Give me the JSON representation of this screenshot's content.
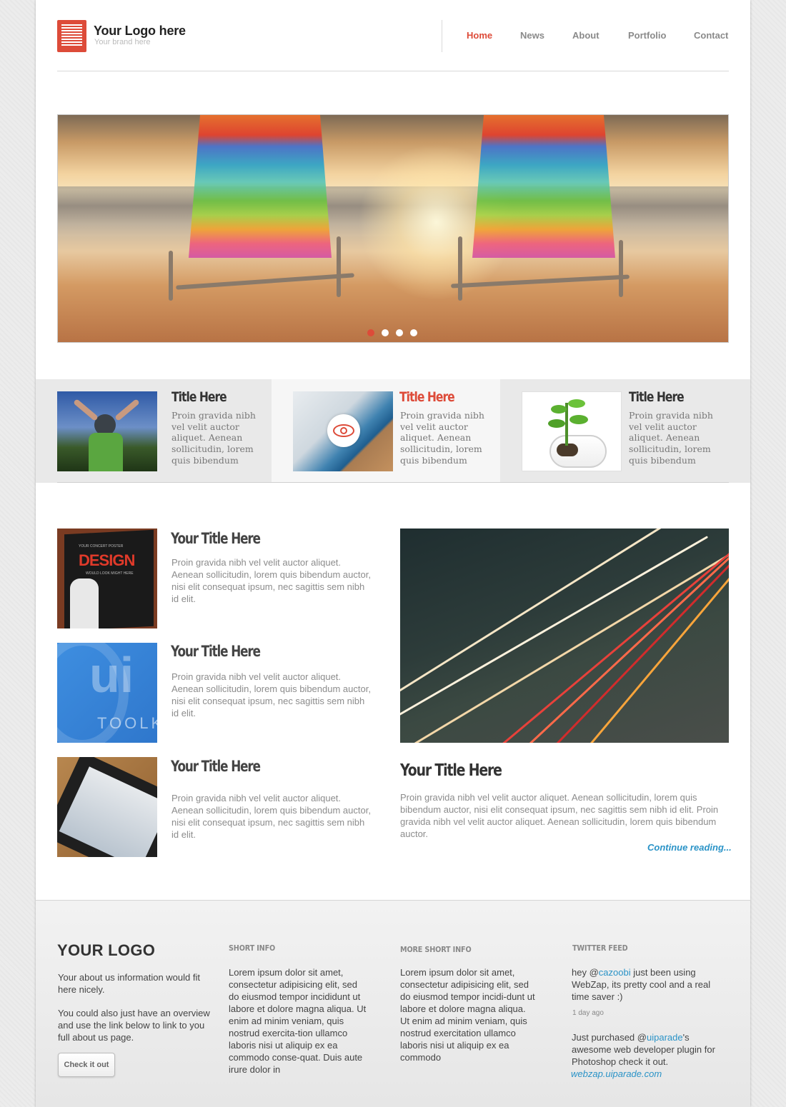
{
  "header": {
    "logo_title": "Your Logo here",
    "logo_subtitle": "Your brand here",
    "nav": [
      "Home",
      "News",
      "About",
      "Portfolio",
      "Contact"
    ],
    "active_nav": "Home",
    "accent_color": "#dd4b39"
  },
  "slider": {
    "dots_count": 4,
    "active_dot": 1
  },
  "features": [
    {
      "title": "Title Here",
      "body": "Proin gravida nibh vel velit auctor aliquet. Aenean sollicitudin, lorem quis bibendum"
    },
    {
      "title": "Title Here",
      "body": "Proin gravida nibh vel velit auctor aliquet. Aenean sollicitudin, lorem quis bibendum"
    },
    {
      "title": "Title Here",
      "body": "Proin gravida nibh vel velit auctor aliquet. Aenean sollicitudin, lorem quis bibendum"
    }
  ],
  "articles": [
    {
      "title": "Your Title Here",
      "body": "Proin gravida nibh vel velit auctor aliquet. Aenean sollicitudin, lorem quis bibendum auctor, nisi elit consequat ipsum, nec sagittis sem nibh id elit.",
      "poster_line1": "YOUR CONCERT POSTER",
      "poster_big": "DESIGN",
      "poster_line2": "WOULD LOOK MIGHT HERE"
    },
    {
      "title": "Your Title Here",
      "body": "Proin gravida nibh vel velit auctor aliquet. Aenean sollicitudin, lorem quis bibendum auctor, nisi elit consequat ipsum, nec sagittis sem nibh id elit.",
      "thumb_big": "ui",
      "thumb_small": "TOOLK"
    },
    {
      "title": "Your Title Here",
      "body": "Proin gravida nibh vel velit auctor aliquet. Aenean sollicitudin, lorem quis bibendum auctor, nisi elit consequat ipsum, nec sagittis sem nibh id elit."
    }
  ],
  "featured": {
    "title": "Your Title Here",
    "body": "Proin gravida nibh vel velit auctor aliquet. Aenean sollicitudin, lorem quis bibendum auctor, nisi elit consequat ipsum, nec sagittis sem nibh id elit. Proin gravida nibh vel velit auctor aliquet. Aenean sollicitudin, lorem quis bibendum auctor.",
    "link": "Continue reading..."
  },
  "footer": {
    "logo": "YOUR LOGO",
    "about1": "Your about us information would fit here nicely.",
    "about2": "You could also just have an overview and use the link below to link to you full about us page.",
    "button": "Check it out",
    "short_info_heading": "SHORT INFO",
    "short_info": "Lorem ipsum dolor sit amet, consectetur adipisicing elit, sed do eiusmod tempor incididunt ut labore et dolore magna aliqua. Ut enim ad minim veniam, quis nostrud exercita-tion ullamco laboris nisi ut aliquip ex ea commodo conse-quat. Duis aute irure dolor in",
    "more_info_heading": "MORE SHORT INFO",
    "more_info": "Lorem ipsum dolor sit amet, consectetur adipisicing elit, sed do eiusmod tempor incidi-dunt ut labore et dolore magna aliqua. Ut enim ad minim veniam, quis nostrud exercitation ullamco laboris nisi ut aliquip ex ea commodo",
    "twitter_heading": "TWITTER FEED",
    "tweet1_pre": "hey @",
    "tweet1_user": "cazoobi",
    "tweet1_post": " just been using WebZap, its pretty cool and a real time saver :)",
    "tweet1_time": "1 day ago",
    "tweet2_pre": "Just purchased @",
    "tweet2_user": "uiparade",
    "tweet2_post": "'s awesome web developer plugin for Photoshop check it out.",
    "tweet2_link": "webzap.uiparade.com"
  }
}
